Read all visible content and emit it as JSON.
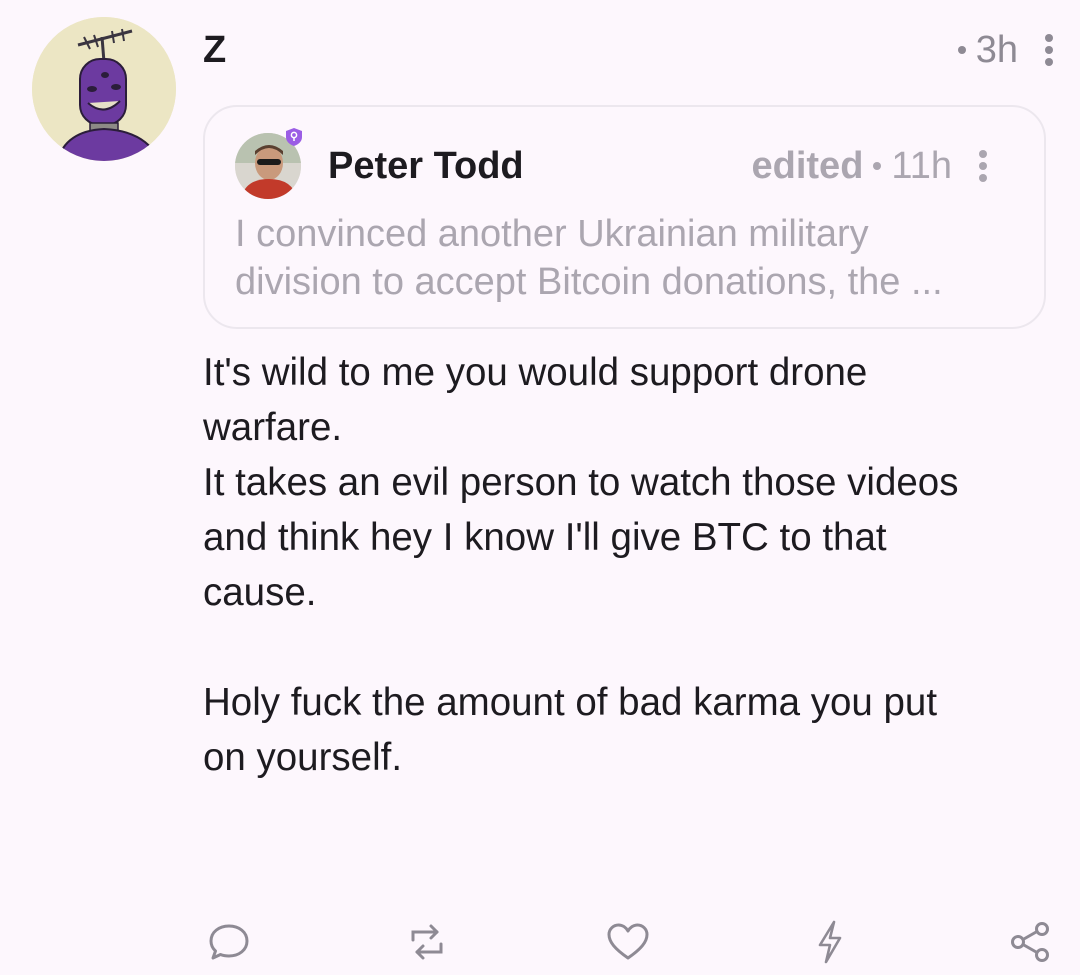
{
  "post": {
    "author": "Z",
    "time": "3h",
    "avatar_icon": "purple-robot-avatar",
    "body_lines": [
      "It's wild to me you would support drone",
      "warfare.",
      "It takes an evil person to watch those videos",
      "and think hey I know I'll give BTC to that",
      "cause.",
      "",
      "Holy fuck the amount of bad karma you put",
      "on yourself."
    ]
  },
  "quote": {
    "author": "Peter Todd",
    "edited_label": "edited",
    "time": "11h",
    "text_lines": [
      "I convinced another Ukrainian military",
      "division to accept Bitcoin donations, the ..."
    ]
  },
  "actions": [
    {
      "name": "reply-icon"
    },
    {
      "name": "repost-icon"
    },
    {
      "name": "like-icon"
    },
    {
      "name": "zap-icon"
    },
    {
      "name": "share-icon"
    }
  ],
  "colors": {
    "background": "#fdf7fd",
    "text": "#1d1b20",
    "muted": "#8e8a94",
    "quote_muted": "#aba6b0",
    "accent": "#7b3fd1"
  }
}
